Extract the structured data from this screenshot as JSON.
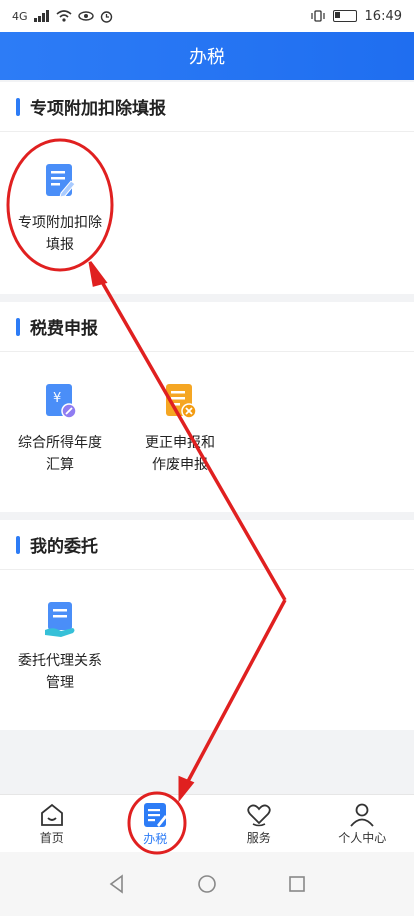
{
  "status_bar": {
    "network_label": "4G",
    "time": "16:49"
  },
  "header": {
    "title": "办税"
  },
  "sections": [
    {
      "title": "专项附加扣除填报",
      "tiles": [
        {
          "label_line1": "专项附加扣除",
          "label_line2": "填报",
          "icon": "edit-document-icon"
        }
      ]
    },
    {
      "title": "税费申报",
      "tiles": [
        {
          "label_line1": "综合所得年度",
          "label_line2": "汇算",
          "icon": "yuan-document-icon"
        },
        {
          "label_line1": "更正申报和",
          "label_line2": "作废申报",
          "icon": "cancel-document-icon"
        }
      ]
    },
    {
      "title": "我的委托",
      "tiles": [
        {
          "label_line1": "委托代理关系",
          "label_line2": "管理",
          "icon": "hand-document-icon"
        }
      ]
    }
  ],
  "tabbar": {
    "tabs": [
      {
        "label": "首页",
        "icon": "home-icon",
        "active": false
      },
      {
        "label": "办税",
        "icon": "tax-document-icon",
        "active": true
      },
      {
        "label": "服务",
        "icon": "heart-hand-icon",
        "active": false
      },
      {
        "label": "个人中心",
        "icon": "person-icon",
        "active": false
      }
    ]
  },
  "colors": {
    "accent": "#2d7cf6",
    "annotation": "#e02020",
    "icon_orange": "#f5a623"
  }
}
